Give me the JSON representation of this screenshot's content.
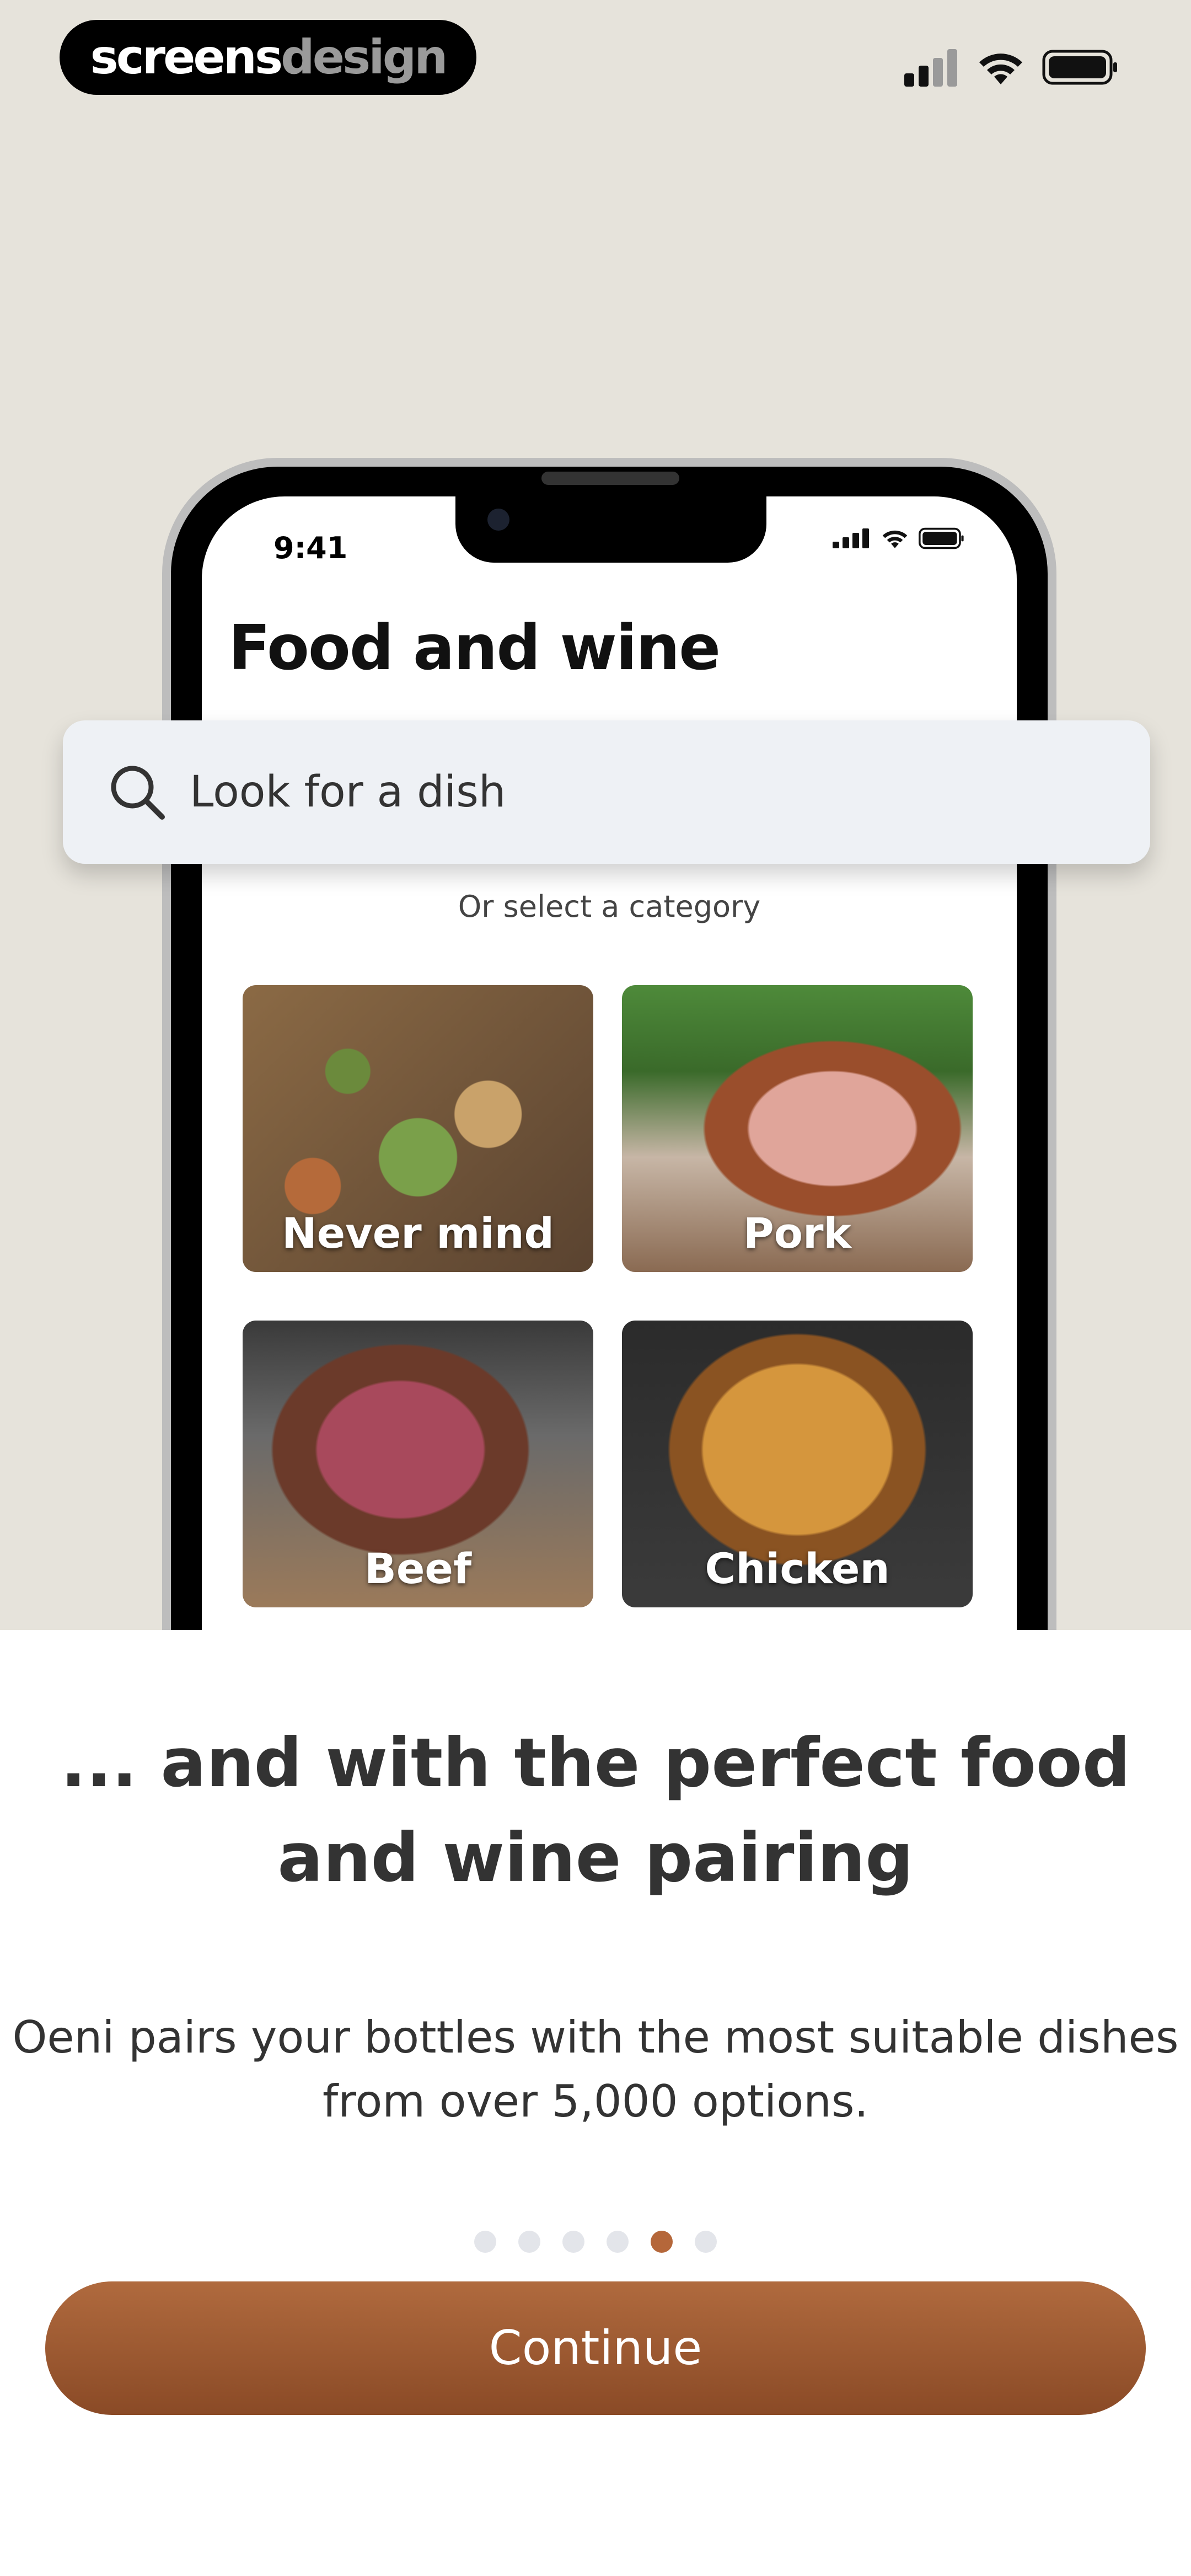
{
  "watermark": {
    "part1": "screens",
    "part2": "design"
  },
  "status_bar": {
    "icons": [
      "signal-icon",
      "wifi-icon",
      "battery-icon"
    ]
  },
  "phone_screen": {
    "time": "9:41",
    "title": "Food and wine",
    "search_placeholder": "Look for a dish",
    "category_hint": "Or select a category",
    "categories": [
      {
        "label": "Never mind"
      },
      {
        "label": "Pork"
      },
      {
        "label": "Beef"
      },
      {
        "label": "Chicken"
      }
    ]
  },
  "sheet": {
    "title": "... and with the perfect food and wine pairing",
    "body": "Oeni pairs your bottles with the most suitable dishes from over 5,000 options.",
    "pagination": {
      "total": 6,
      "active_index": 4
    },
    "continue_label": "Continue"
  },
  "colors": {
    "background": "#e6e3db",
    "accent": "#b5673a",
    "button": "#9c5a33"
  }
}
